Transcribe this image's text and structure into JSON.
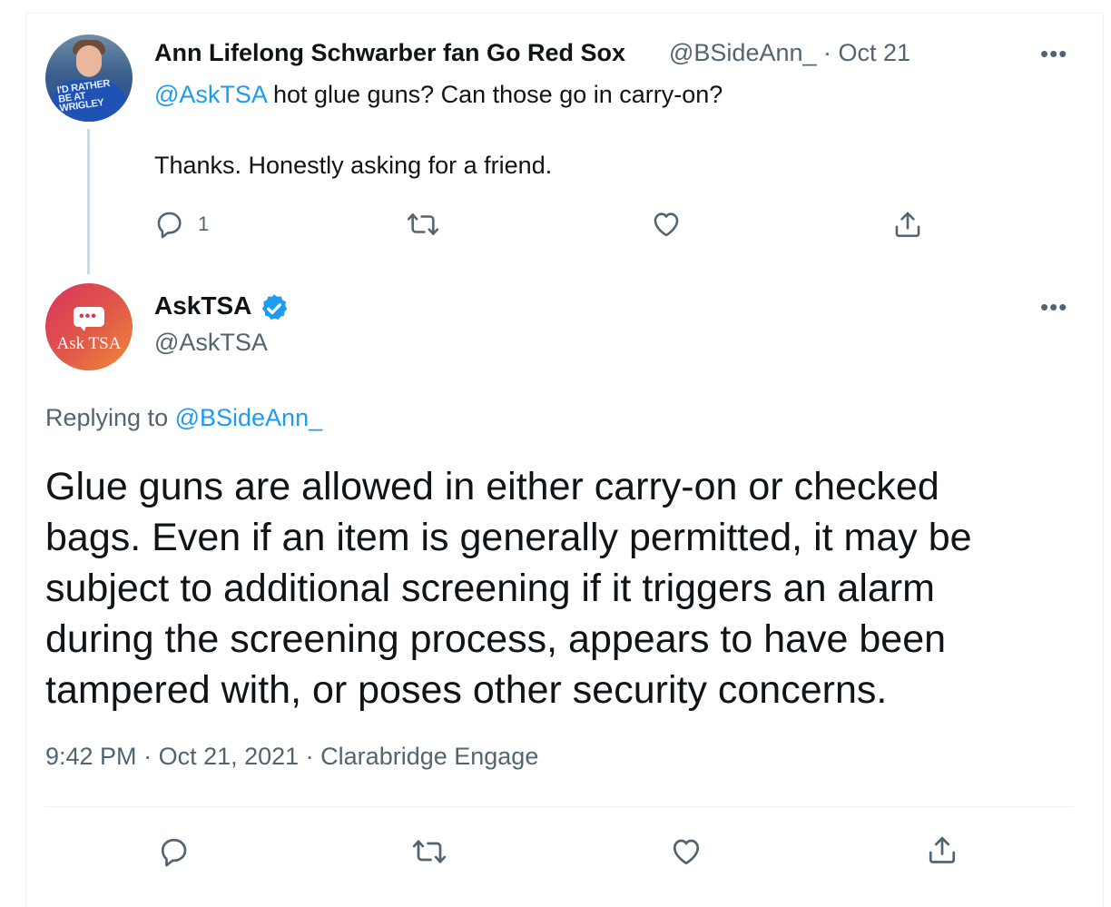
{
  "reply_tweet": {
    "avatar_shirt_text": "I'D RATHER BE AT WRIGLEY",
    "display_name": "Ann Lifelong Schwarber fan Go Red Sox",
    "handle": "@BSideAnn_",
    "separator": "·",
    "date": "Oct 21",
    "more_label": "•••",
    "mention": "@AskTSA",
    "text_line1": " hot glue guns? Can those go in carry-on?",
    "text_line2": "Thanks. Honestly asking for a friend.",
    "reply_count": "1",
    "icons": [
      "reply-icon",
      "retweet-icon",
      "like-icon",
      "share-icon"
    ]
  },
  "main_tweet": {
    "avatar_logo_text": "Ask TSA",
    "display_name": "AskTSA",
    "handle": "@AskTSA",
    "more_label": "•••",
    "verified": true,
    "replying_prefix": "Replying to ",
    "replying_handle": "@BSideAnn_",
    "body_lines": [
      "Glue guns are allowed in either carry-on or checked",
      "bags. Even if an item is generally permitted, it may be",
      "subject to additional screening if it triggers an alarm",
      "during the screening process, appears to have been",
      "tampered with, or poses other security concerns."
    ],
    "time": "9:42 PM",
    "meta_sep1": " · ",
    "full_date": "Oct 21, 2021",
    "meta_sep2": " · ",
    "source": "Clarabridge Engage",
    "icons": [
      "reply-icon",
      "retweet-icon",
      "like-icon",
      "share-icon"
    ]
  },
  "colors": {
    "text": "#0f1419",
    "secondary": "#536471",
    "link": "#1d9bf0",
    "divider": "#eff3f4",
    "thread_line": "#cfd9de"
  }
}
